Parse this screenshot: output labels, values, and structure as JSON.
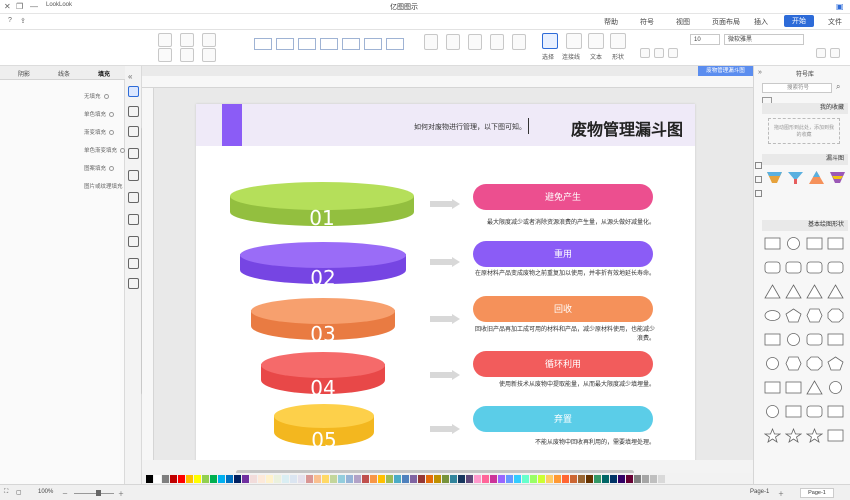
{
  "window": {
    "title": "亿图图示",
    "brand_label": "LookLook"
  },
  "ribbon": {
    "tabs": [
      "文件",
      "开始",
      "插入",
      "页面布局",
      "视图",
      "符号",
      "帮助"
    ],
    "active_tab": "开始"
  },
  "toolbar": {
    "font_name": "微软雅黑",
    "font_size": "10",
    "labels": {
      "select": "选择",
      "text": "文本",
      "connector": "连接线",
      "shape": "形状"
    }
  },
  "left_panel": {
    "tabs": [
      "填充",
      "线条",
      "阴影"
    ],
    "active_tab": "填充",
    "options": [
      "无填充",
      "单色填充",
      "渐变填充",
      "单色渐变填充",
      "图案填充",
      "图片或纹理填充"
    ]
  },
  "document_tab": {
    "label": "废物管理漏斗图"
  },
  "diagram": {
    "title": "废物管理漏斗图",
    "subtitle": "如何对废物进行管理，以下图可知。",
    "accent_color": "#8b5cf6",
    "layers": [
      {
        "num": "01",
        "label": "避免产生",
        "desc": "最大限度减少或者消除资源浪费的产生量，从源头做好减量化。",
        "color": "#a3d54a"
      },
      {
        "num": "02",
        "label": "重用",
        "desc": "在原材料产品变成废物之前重复加以使用，并非折有效地延长寿命。",
        "color": "#8b5cf6"
      },
      {
        "num": "03",
        "label": "回收",
        "desc": "回收旧产品再加工成可用的材料和产品，减少原材料使用，也能减少浪费。",
        "color": "#f5915a"
      },
      {
        "num": "04",
        "label": "循环利用",
        "desc": "使用新技术从废物中提取能量，从而最大限度减少填埋量。",
        "color": "#f25c5c"
      },
      {
        "num": "05",
        "label": "弃置",
        "desc": "不能从废物中回收再利用的，需要填埋处理。",
        "color": "#fcc934"
      }
    ],
    "pill_colors": [
      "#ec4f8f",
      "#8b5cf6",
      "#f5915a",
      "#f25c5c",
      "#5bcde8"
    ]
  },
  "shape_panel": {
    "title": "符号库",
    "search_placeholder": "搜索符号",
    "sections": [
      "我的收藏",
      "漏斗图",
      "基本绘图形状"
    ],
    "favorites_hint": "拖动图形到此处，添加到我的收藏"
  },
  "statusbar": {
    "page_label": "Page-1",
    "page_tab": "Page-1",
    "zoom": "100%"
  },
  "palette": [
    "#000000",
    "#ffffff",
    "#7f7f7f",
    "#c00000",
    "#ff0000",
    "#ffc000",
    "#ffff00",
    "#92d050",
    "#00b050",
    "#00b0f0",
    "#0070c0",
    "#002060",
    "#7030a0",
    "#f2dcdb",
    "#fde9d9",
    "#fff2cc",
    "#ebf1de",
    "#daeef3",
    "#dbe5f1",
    "#e5e0ec",
    "#d99694",
    "#fac090",
    "#ffd966",
    "#c3d69b",
    "#93cddd",
    "#95b3d7",
    "#b2a2c7",
    "#c0504d",
    "#f79646",
    "#ffc000",
    "#9bbb59",
    "#4bacc6",
    "#4f81bd",
    "#8064a2",
    "#953735",
    "#e46c0a",
    "#bf9000",
    "#77933c",
    "#31859c",
    "#17375e",
    "#5f497a",
    "#ff99cc",
    "#ff6699",
    "#cc3399",
    "#9966ff",
    "#6699ff",
    "#33ccff",
    "#66ffcc",
    "#99ff66",
    "#ccff33",
    "#ffcc66",
    "#ff9933",
    "#ff6633",
    "#cc6633",
    "#996633",
    "#663300",
    "#339966",
    "#006666",
    "#003366",
    "#330066",
    "#660033",
    "#808080",
    "#a6a6a6",
    "#bfbfbf",
    "#d9d9d9"
  ]
}
